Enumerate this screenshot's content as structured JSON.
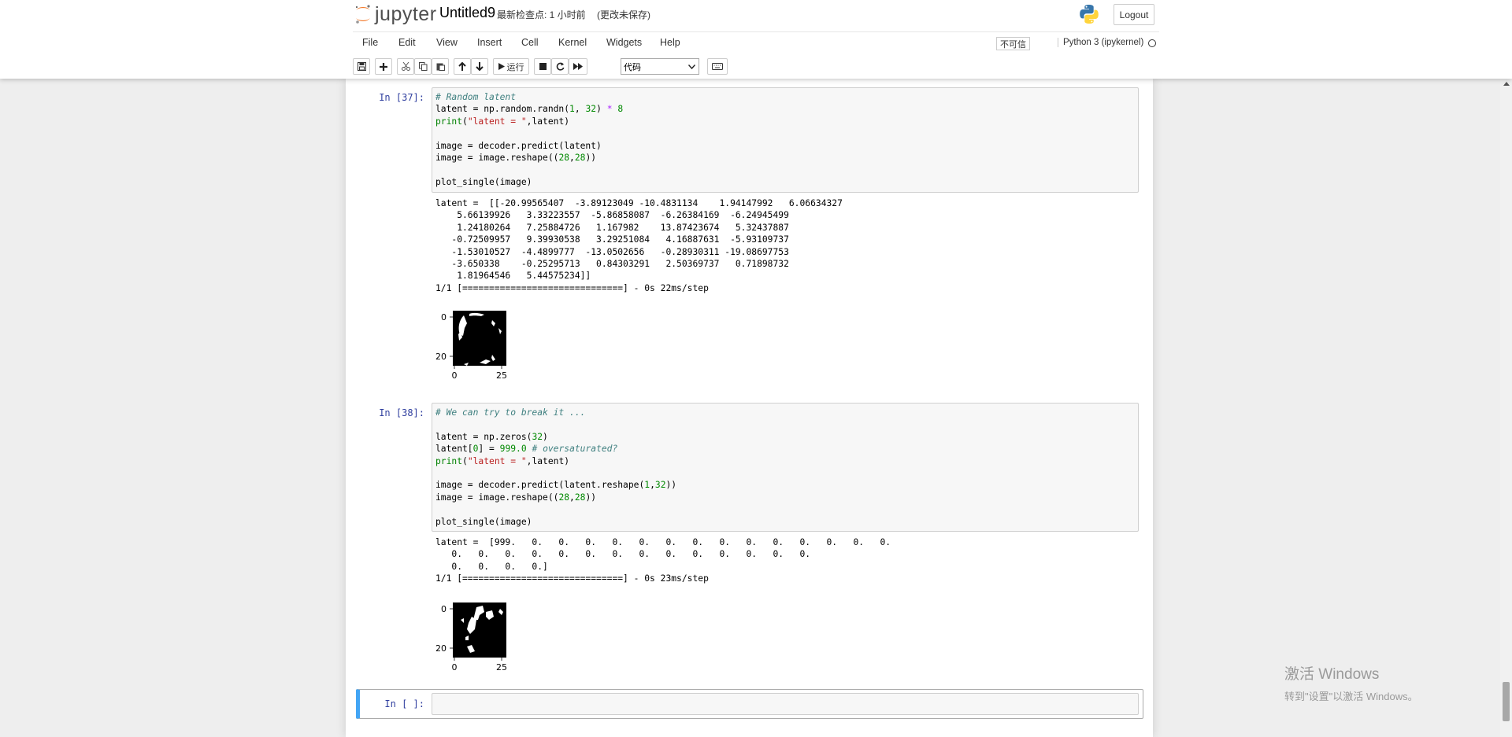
{
  "header": {
    "logo_text": "jupyter",
    "notebook_name": "Untitled9",
    "checkpoint": "最新检查点: 1 小时前",
    "autosave": "(更改未保存)",
    "logout_label": "Logout"
  },
  "menubar": {
    "items": [
      "File",
      "Edit",
      "View",
      "Insert",
      "Cell",
      "Kernel",
      "Widgets",
      "Help"
    ],
    "trust_label": "不可信",
    "kernel_name": "Python 3 (ipykernel)"
  },
  "toolbar": {
    "run_label": "运行",
    "cell_type": "代码",
    "icons": [
      "save-icon",
      "plus-icon",
      "cut-icon",
      "copy-icon",
      "paste-icon",
      "arrow-up-icon",
      "arrow-down-icon",
      "run-icon",
      "stop-icon",
      "restart-icon",
      "fast-forward-icon",
      "keyboard-icon"
    ]
  },
  "cells": [
    {
      "prompt": "In  [37]:",
      "output": "latent =  [[-20.99565407  -3.89123049 -10.4831134    1.94147992   6.06634327\n    5.66139926   3.33223557  -5.86858087  -6.26384169  -6.24945499\n    1.24180264   7.25884726   1.167982    13.87423674   5.32437887\n   -0.72509957   9.39930538   3.29251084   4.16887631  -5.93109737\n   -1.53010527  -4.4899777  -13.0502656   -0.28930311 -19.08697753\n   -3.650338    -0.25295713   0.84303291   2.50369737   0.71898732\n    1.81964546   5.44575234]]\n1/1 [==============================] - 0s 22ms/step",
      "plot_ticks": {
        "y": [
          "0",
          "20"
        ],
        "x": [
          "0",
          "25"
        ]
      }
    },
    {
      "prompt": "In  [38]:",
      "output": "latent =  [999.   0.   0.   0.   0.   0.   0.   0.   0.   0.   0.   0.   0.   0.   0.\n   0.   0.   0.   0.   0.   0.   0.   0.   0.   0.   0.   0.   0.   0.\n   0.   0.   0.   0.]\n1/1 [==============================] - 0s 23ms/step",
      "plot_ticks": {
        "y": [
          "0",
          "20"
        ],
        "x": [
          "0",
          "25"
        ]
      }
    },
    {
      "prompt": "In  [ ]:"
    }
  ],
  "watermark": {
    "line1": "激活 Windows",
    "line2": "转到\"设置\"以激活 Windows。"
  },
  "colors": {
    "prompt": "#303f9f",
    "selected_cell_border": "#42a5f5",
    "comment": "#408080",
    "number": "#008800",
    "string": "#ba2121"
  }
}
